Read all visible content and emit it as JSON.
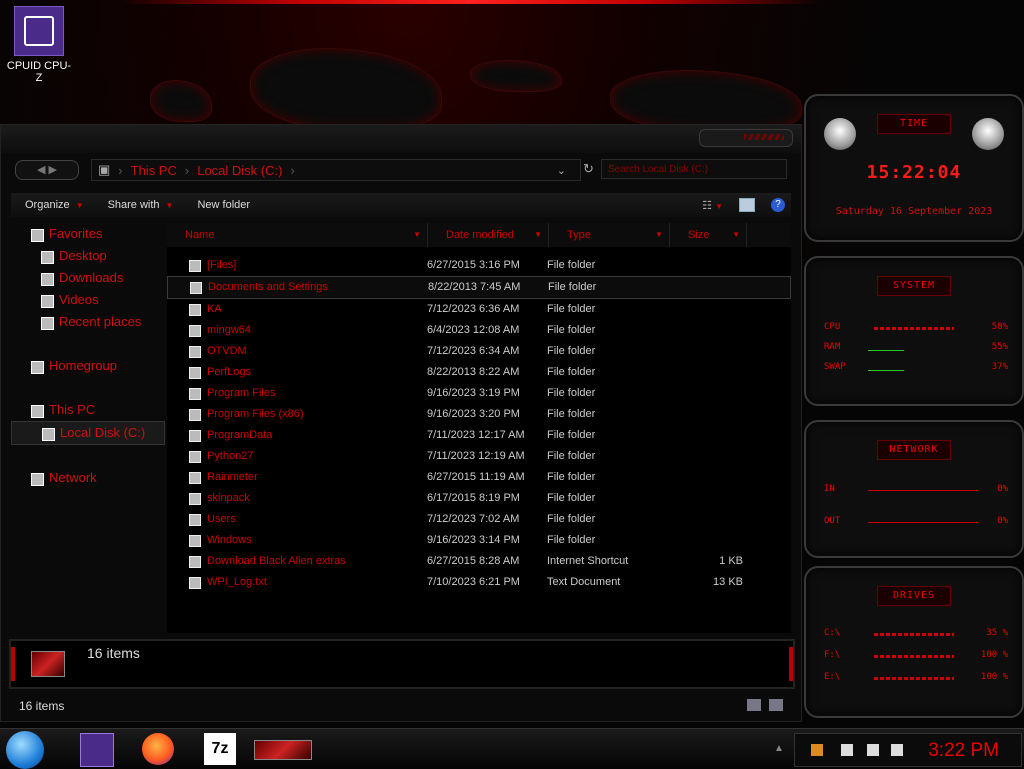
{
  "desktop": {
    "icon_label": "CPUID CPU-Z"
  },
  "explorer": {
    "breadcrumb": [
      "This PC",
      "Local Disk (C:)"
    ],
    "search_placeholder": "Search Local Disk (C:)",
    "toolbar": {
      "organize": "Organize",
      "share_with": "Share with",
      "new_folder": "New folder"
    },
    "nav": {
      "favorites": "Favorites",
      "desktop": "Desktop",
      "downloads": "Downloads",
      "videos": "Videos",
      "recent_places": "Recent places",
      "homegroup": "Homegroup",
      "this_pc": "This PC",
      "local_disk": "Local Disk (C:)",
      "network": "Network"
    },
    "columns": {
      "name": "Name",
      "date": "Date modified",
      "type": "Type",
      "size": "Size"
    },
    "files": [
      {
        "name": "[Files]",
        "date": "6/27/2015 3:16 PM",
        "type": "File folder",
        "size": ""
      },
      {
        "name": "Documents and Settings",
        "date": "8/22/2013 7:45 AM",
        "type": "File folder",
        "size": ""
      },
      {
        "name": "KA",
        "date": "7/12/2023 6:36 AM",
        "type": "File folder",
        "size": ""
      },
      {
        "name": "mingw64",
        "date": "6/4/2023 12:08 AM",
        "type": "File folder",
        "size": ""
      },
      {
        "name": "OTVDM",
        "date": "7/12/2023 6:34 AM",
        "type": "File folder",
        "size": ""
      },
      {
        "name": "PerfLogs",
        "date": "8/22/2013 8:22 AM",
        "type": "File folder",
        "size": ""
      },
      {
        "name": "Program Files",
        "date": "9/16/2023 3:19 PM",
        "type": "File folder",
        "size": ""
      },
      {
        "name": "Program Files (x86)",
        "date": "9/16/2023 3:20 PM",
        "type": "File folder",
        "size": ""
      },
      {
        "name": "ProgramData",
        "date": "7/11/2023 12:17 AM",
        "type": "File folder",
        "size": ""
      },
      {
        "name": "Python27",
        "date": "7/11/2023 12:19 AM",
        "type": "File folder",
        "size": ""
      },
      {
        "name": "Rainmeter",
        "date": "6/27/2015 11:19 AM",
        "type": "File folder",
        "size": ""
      },
      {
        "name": "skinpack",
        "date": "6/17/2015 8:19 PM",
        "type": "File folder",
        "size": ""
      },
      {
        "name": "Users",
        "date": "7/12/2023 7:02 AM",
        "type": "File folder",
        "size": ""
      },
      {
        "name": "Windows",
        "date": "9/16/2023 3:14 PM",
        "type": "File folder",
        "size": ""
      },
      {
        "name": "Download Black Alien extras",
        "date": "6/27/2015 8:28 AM",
        "type": "Internet Shortcut",
        "size": "1 KB"
      },
      {
        "name": "WPI_Log.txt",
        "date": "7/10/2023 6:21 PM",
        "type": "Text Document",
        "size": "13 KB"
      }
    ],
    "details_count": "16 items",
    "status_count": "16 items"
  },
  "gadgets": {
    "time": {
      "title": "TIME",
      "clock": "15:22:04",
      "date": "Saturday 16 September 2023"
    },
    "system": {
      "title": "SYSTEM",
      "rows": [
        {
          "label": "CPU",
          "value": "58%"
        },
        {
          "label": "RAM",
          "value": "55%"
        },
        {
          "label": "SWAP",
          "value": "37%"
        }
      ]
    },
    "network": {
      "title": "NETWORK",
      "rows": [
        {
          "label": "IN",
          "value": "0%"
        },
        {
          "label": "OUT",
          "value": "0%"
        }
      ]
    },
    "drives": {
      "title": "DRIVES",
      "rows": [
        {
          "label": "C:\\",
          "value": "35 %"
        },
        {
          "label": "F:\\",
          "value": "100 %"
        },
        {
          "label": "E:\\",
          "value": "100 %"
        }
      ]
    }
  },
  "taskbar": {
    "clock": "3:22 PM",
    "sevenzip_label": "7z"
  },
  "colors": {
    "accent": "#d01010",
    "background": "#050505"
  }
}
